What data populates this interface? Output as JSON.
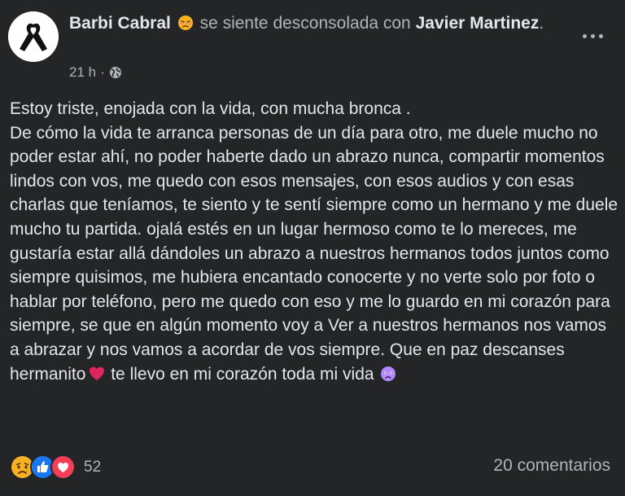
{
  "header": {
    "author": "Barbi Cabral",
    "feeling": "se siente desconsolada con",
    "tagged": "Javier Martinez",
    "period": ".",
    "feeling_icon": "sad-face-icon",
    "timestamp": "21 h",
    "separator": "·",
    "audience_icon": "globe-icon"
  },
  "post": {
    "text": "Estoy triste, enojada con la vida, con mucha bronca .\nDe cómo la vida te arranca personas de un día para otro, me duele mucho no poder estar ahí, no poder haberte dado un abrazo nunca, compartir momentos lindos con vos, me quedo con esos mensajes, con esos audios y con esas charlas que teníamos, te siento y te sentí siempre como un hermano y me duele mucho tu partida. ojalá estés en un lugar hermoso como te lo mereces, me gustaría estar allá dándoles un abrazo a nuestros hermanos todos juntos como siempre quisimos, me hubiera encantado conocerte y no verte solo por foto o hablar por teléfono, pero me quedo con eso y me lo guardo en mi corazón para siempre, se que en algún momento voy a Ver a nuestros hermanos nos vamos a abrazar y nos vamos a acordar de vos siempre. Que en paz descanses hermanito",
    "text_end": " te llevo en mi corazón toda mi vida ",
    "inline_icons": [
      "red-heart-icon",
      "sad-face-icon"
    ]
  },
  "footer": {
    "reaction_icons": [
      "sad-reaction-icon",
      "like-reaction-icon",
      "love-reaction-icon"
    ],
    "reaction_count": "52",
    "comments": "20 comentarios"
  },
  "colors": {
    "background": "#242526",
    "text": "#e4e6eb",
    "secondary": "#b0b3b8",
    "like": "#1877f2",
    "love": "#f33e58",
    "sad": "#f7b125"
  }
}
